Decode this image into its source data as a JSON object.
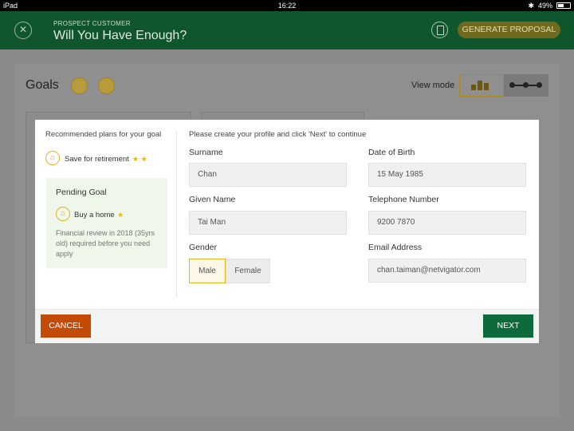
{
  "status_bar": {
    "device": "iPad",
    "time": "16:22",
    "battery": "49%"
  },
  "header": {
    "subtitle": "PROSPECT CUSTOMER",
    "title": "Will You Have Enough?",
    "close_glyph": "✕",
    "generate_label": "GENERATE PROPOSAL"
  },
  "goals": {
    "title": "Goals",
    "view_mode_label": "View mode"
  },
  "modal": {
    "recommend_title": "Recommended plans for your goal",
    "recommended": [
      {
        "label": "Save for retirement",
        "stars": "★ ★",
        "icon": "retirement-icon"
      }
    ],
    "pending": {
      "title": "Pending Goal",
      "item": {
        "label": "Buy a home",
        "stars": "★",
        "icon": "home-icon"
      },
      "description": "Financial review in 2018 (35yrs old) required before you need apply"
    },
    "instruction": "Please create your profile and click 'Next' to continue",
    "fields": {
      "surname": {
        "label": "Surname",
        "value": "Chan"
      },
      "dob": {
        "label": "Date of Birth",
        "value": "15 May 1985"
      },
      "given_name": {
        "label": "Given Name",
        "value": "Tai Man"
      },
      "telephone": {
        "label": "Telephone Number",
        "value": "9200 7870"
      },
      "gender": {
        "label": "Gender",
        "options": [
          "Male",
          "Female"
        ],
        "selected": "Male"
      },
      "email": {
        "label": "Email Address",
        "value": "chan.taiman@netvigator.com"
      }
    },
    "cancel_label": "CANCEL",
    "next_label": "NEXT"
  },
  "colors": {
    "header": "#10562d",
    "accent": "#e3b324",
    "cancel": "#c44b06",
    "next": "#0d6a3a",
    "pending_bg": "#eef7ea"
  }
}
